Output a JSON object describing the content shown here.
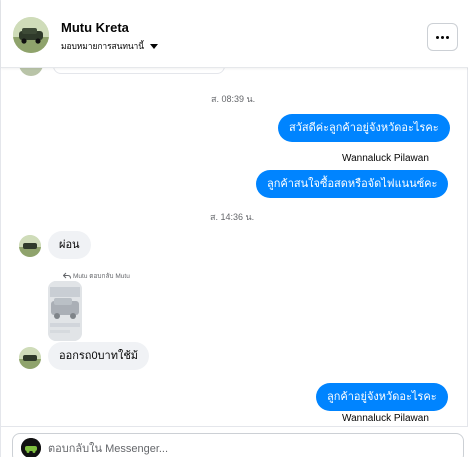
{
  "header": {
    "name": "Mutu Kreta",
    "subtitle": "มอบหมายการสนทนานี้",
    "more_icon": "more-horizontal-icon"
  },
  "conversation": {
    "timestamps": [
      "ส. 08:39 น.",
      "ส. 14:36 น."
    ],
    "outgoing": [
      "สวัสดีค่ะลูกค้าอยู่จังหวัดอะไรคะ",
      "ลูกค้าสนใจซื้อสดหรือจัดไฟแนนซ์คะ",
      "ลูกค้าอยู่จังหวัดอะไรคะ"
    ],
    "sender_label": "Wannaluck Pilawan",
    "incoming": [
      "ผ่อน",
      "ออกรถ0บาทใช้ม้"
    ],
    "reply_note": "Mutu ตอบกลับ Mutu",
    "reply_icon": "reply-arrow-icon"
  },
  "composer": {
    "placeholder": "ตอบกลับใน Messenger..."
  },
  "colors": {
    "outgoing_bubble": "#0084ff",
    "incoming_bubble": "#f0f2f5",
    "secondary_text": "#65676b"
  }
}
